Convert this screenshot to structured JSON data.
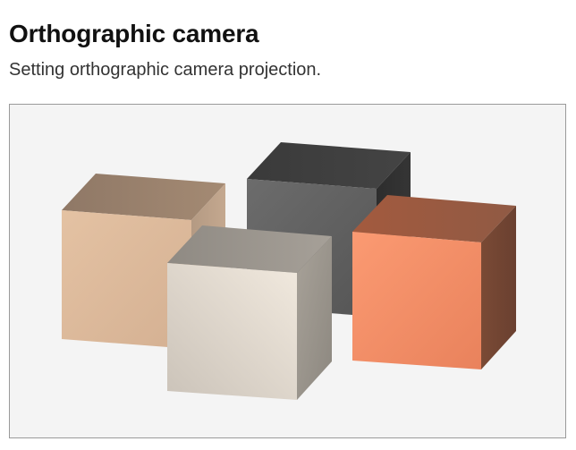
{
  "page": {
    "title": "Orthographic camera",
    "subtitle": "Setting orthographic camera projection."
  },
  "scene": {
    "background": "#f4f4f4",
    "border": "#9a9a9a",
    "projection": "orthographic",
    "cubes": [
      {
        "name": "tan-cube",
        "color": "#d9b89a"
      },
      {
        "name": "dark-gray-cube",
        "color": "#5e5e5e"
      },
      {
        "name": "light-gray-cube",
        "color": "#ddd6cc"
      },
      {
        "name": "orange-cube",
        "color": "#f0906a"
      }
    ]
  }
}
